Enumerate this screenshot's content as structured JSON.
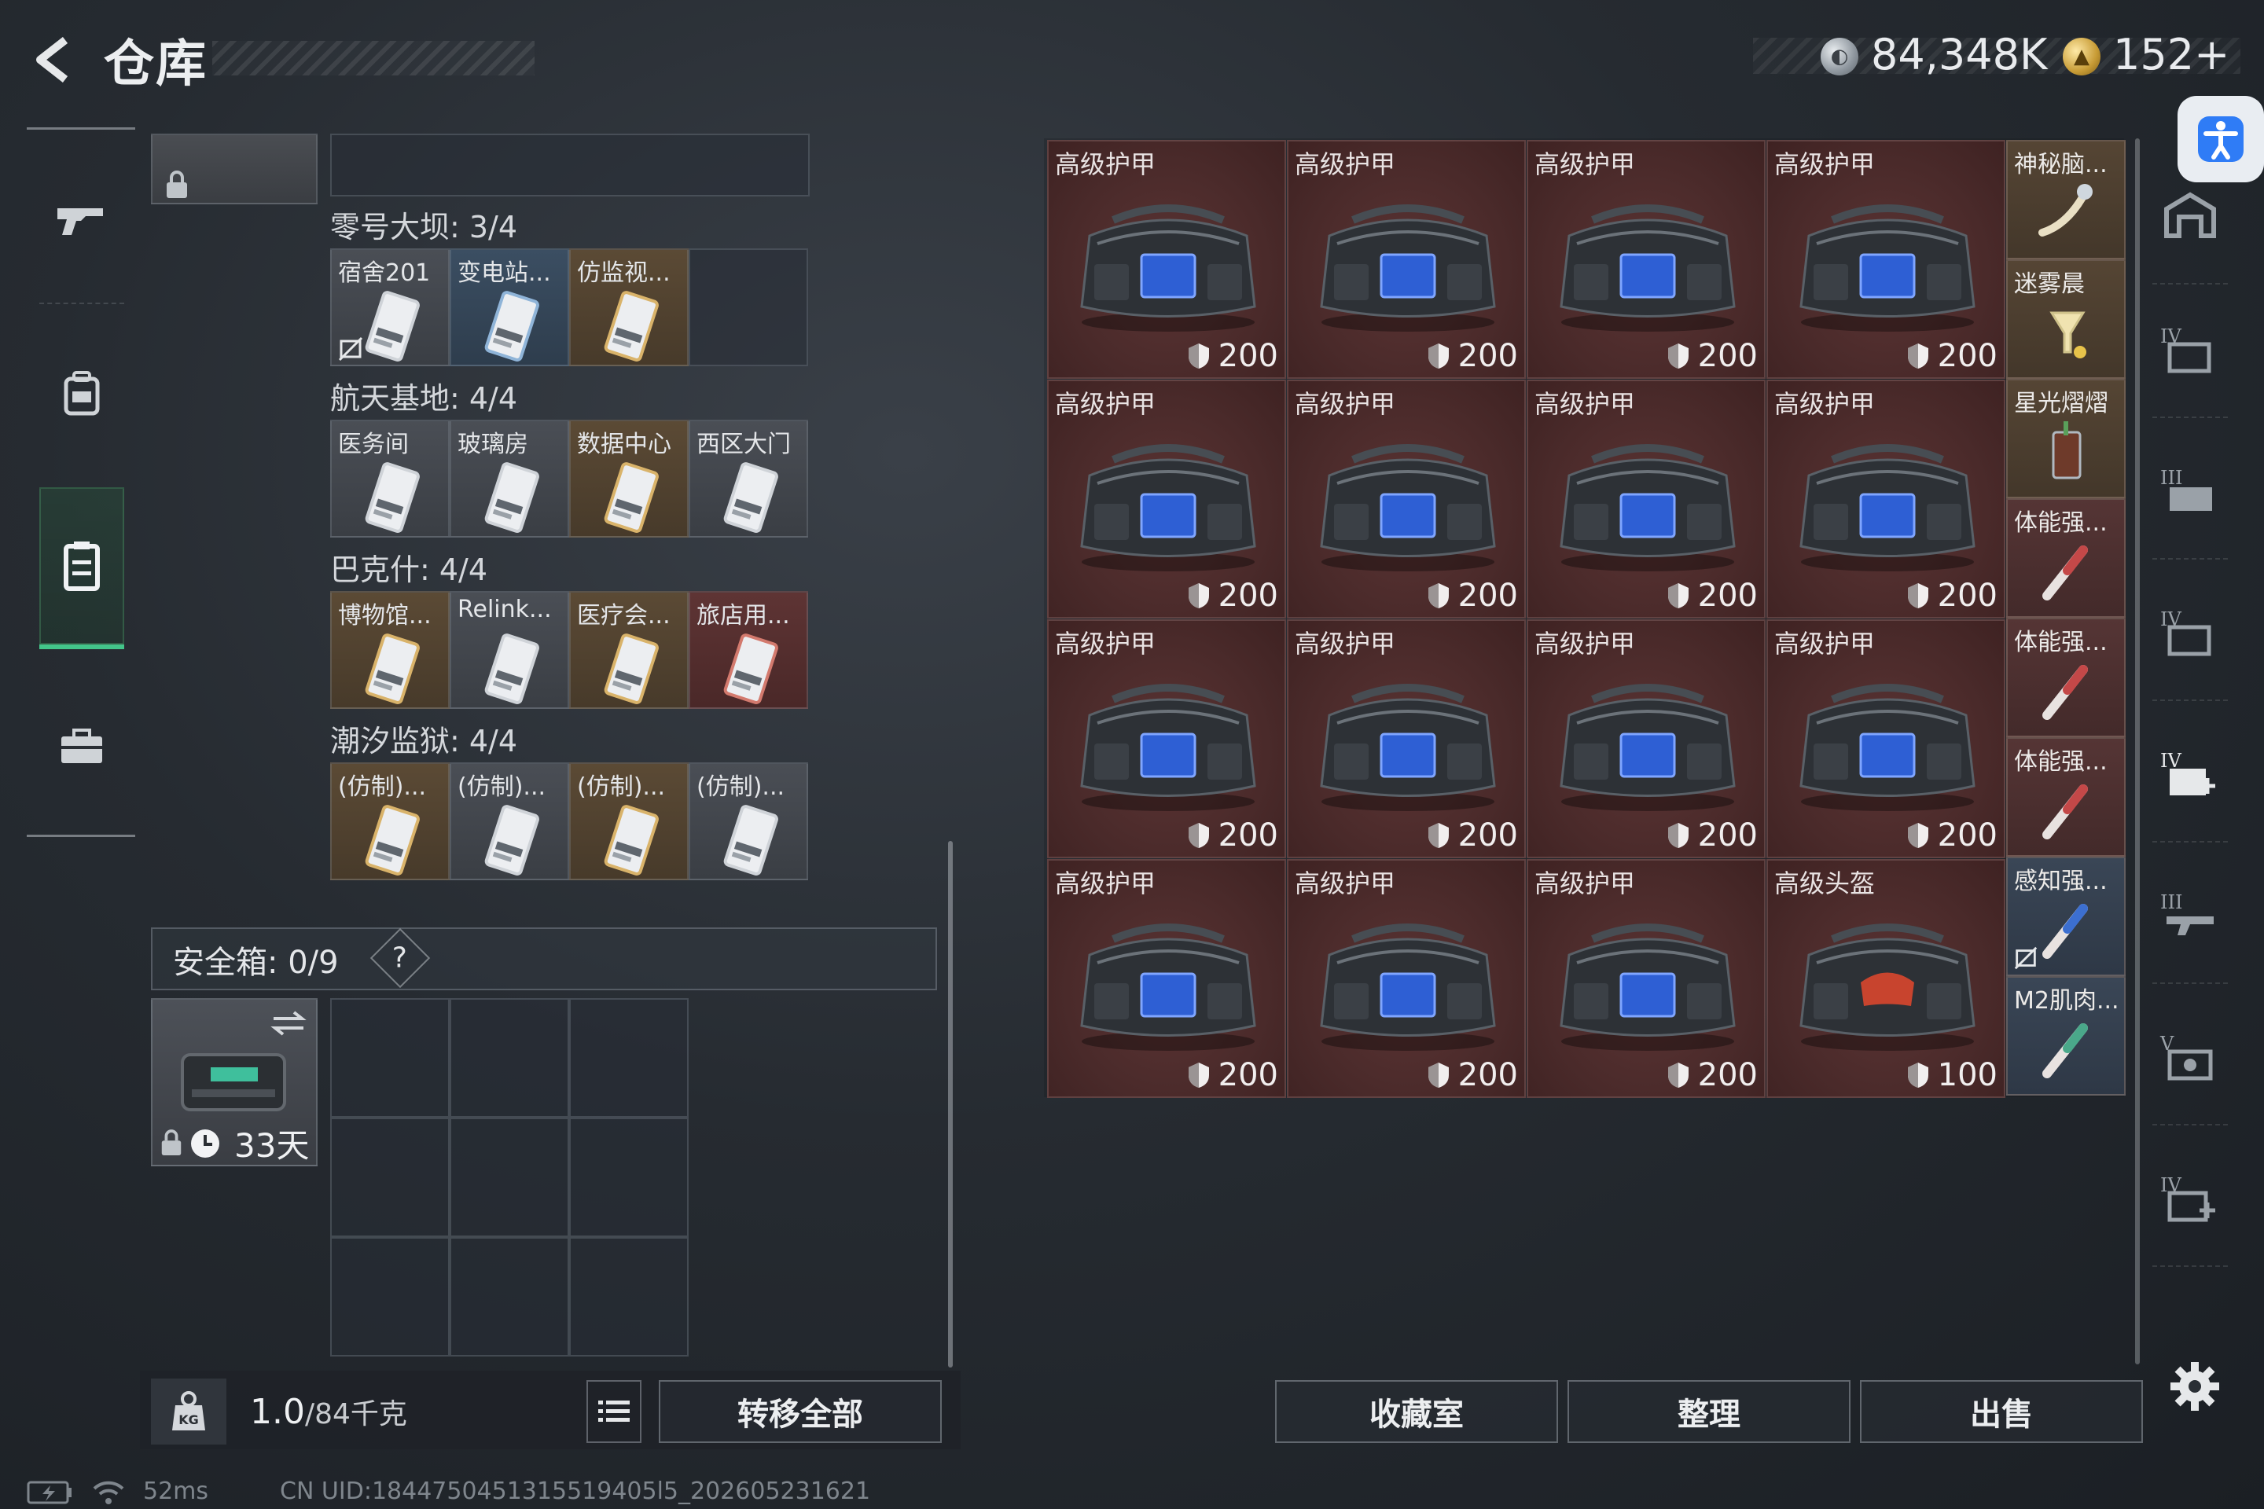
{
  "header": {
    "title": "仓库",
    "silver_value": "84,348K",
    "gold_value": "152+"
  },
  "left_panel": {
    "categories": [
      {
        "label": "零号大坝: 3/4",
        "keys": [
          {
            "name": "宿舍201",
            "tint": "white",
            "bound_icon": true
          },
          {
            "name": "变电站...",
            "tint": "blue"
          },
          {
            "name": "仿监视...",
            "tint": "gold"
          }
        ]
      },
      {
        "label": "航天基地: 4/4",
        "keys": [
          {
            "name": "医务间",
            "tint": "white"
          },
          {
            "name": "玻璃房",
            "tint": "white"
          },
          {
            "name": "数据中心",
            "tint": "gold"
          },
          {
            "name": "西区大门",
            "tint": "white"
          }
        ]
      },
      {
        "label": "巴克什: 4/4",
        "keys": [
          {
            "name": "博物馆...",
            "tint": "gold"
          },
          {
            "name": "Relink...",
            "tint": "white"
          },
          {
            "name": "医疗会...",
            "tint": "gold"
          },
          {
            "name": "旅店用...",
            "tint": "red"
          }
        ]
      },
      {
        "label": "潮汐监狱: 4/4",
        "keys": [
          {
            "name": "(仿制)...",
            "tint": "gold"
          },
          {
            "name": "(仿制)...",
            "tint": "white"
          },
          {
            "name": "(仿制)...",
            "tint": "gold"
          },
          {
            "name": "(仿制)...",
            "tint": "white"
          }
        ]
      }
    ],
    "safebox": {
      "label": "安全箱:  0/9",
      "help": "?",
      "days": "33天"
    },
    "weight": {
      "current": "1.0",
      "capacity": "/84千克"
    },
    "transfer_all": "转移全部"
  },
  "right_panel": {
    "armor_items": [
      {
        "name": "高级护甲",
        "durability": "200"
      },
      {
        "name": "高级护甲",
        "durability": "200"
      },
      {
        "name": "高级护甲",
        "durability": "200"
      },
      {
        "name": "高级护甲",
        "durability": "200"
      },
      {
        "name": "高级护甲",
        "durability": "200"
      },
      {
        "name": "高级护甲",
        "durability": "200"
      },
      {
        "name": "高级护甲",
        "durability": "200"
      },
      {
        "name": "高级护甲",
        "durability": "200"
      },
      {
        "name": "高级护甲",
        "durability": "200"
      },
      {
        "name": "高级护甲",
        "durability": "200"
      },
      {
        "name": "高级护甲",
        "durability": "200"
      },
      {
        "name": "高级护甲",
        "durability": "200"
      },
      {
        "name": "高级护甲",
        "durability": "200"
      },
      {
        "name": "高级护甲",
        "durability": "200"
      },
      {
        "name": "高级护甲",
        "durability": "200"
      },
      {
        "name": "高级头盔",
        "durability": "100"
      }
    ],
    "side_items": [
      {
        "name": "神秘脑...",
        "tint": "gold"
      },
      {
        "name": "迷雾晨",
        "tint": "gold"
      },
      {
        "name": "星光熠熠",
        "tint": "gold"
      },
      {
        "name": "体能强...",
        "tint": "red"
      },
      {
        "name": "体能强...",
        "tint": "red"
      },
      {
        "name": "体能强...",
        "tint": "red"
      },
      {
        "name": "感知强...",
        "tint": "blue"
      },
      {
        "name": "M2肌肉...",
        "tint": "blue"
      }
    ],
    "buttons": {
      "collection": "收藏室",
      "organize": "整理",
      "sell": "出售"
    }
  },
  "status": {
    "ping": "52ms",
    "uid": "CN UID:1844750451315519405l5_202605231621"
  },
  "colors": {
    "accent_green": "#43c58a",
    "armor_bg": "#4a2a2a"
  }
}
